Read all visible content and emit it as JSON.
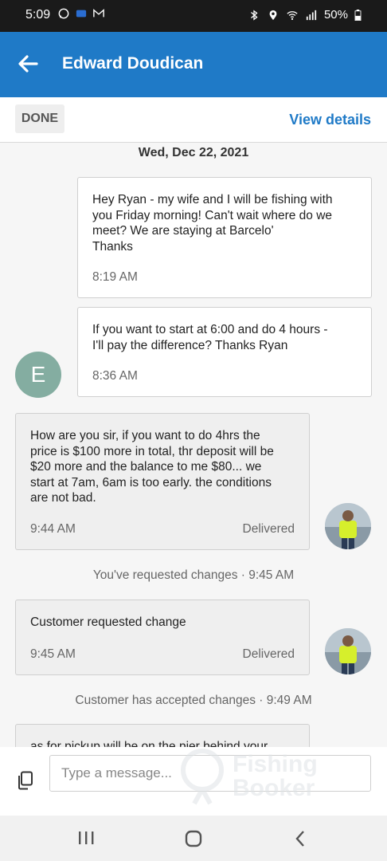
{
  "status_bar": {
    "time": "5:09",
    "battery": "50%",
    "icons": [
      "whatsapp-icon",
      "app-icon",
      "gmail-icon",
      "bluetooth-icon",
      "location-icon",
      "wifi-icon",
      "signal-icon",
      "battery-icon"
    ]
  },
  "header": {
    "title": "Edward Doudican",
    "back_icon": "arrow-left-icon",
    "color": "#1f7ac7"
  },
  "toolbar": {
    "done_label": "DONE",
    "view_details_label": "View details"
  },
  "chat": {
    "date": "Wed, Dec 22, 2021",
    "messages": [
      {
        "direction": "incoming",
        "text": "Hey Ryan - my wife and I will be fishing with\nyou Friday morning! Can't wait where do we\nmeet? We are staying at Barcelo'\nThanks",
        "time": "8:19 AM"
      },
      {
        "direction": "incoming",
        "text": "If you want to start at 6:00 and do 4 hours -\nI'll pay the difference? Thanks Ryan",
        "time": "8:36 AM",
        "avatar_letter": "E"
      },
      {
        "direction": "outgoing",
        "text": "How are you sir, if you want to do 4hrs the\nprice is $100 more in total, thr deposit will be\n$20 more and the balance to me $80... we\nstart at 7am, 6am is too early. the conditions\nare not bad.",
        "time": "9:44 AM",
        "status": "Delivered"
      },
      {
        "direction": "outgoing",
        "text": "Customer requested change",
        "time": "9:45 AM",
        "status": "Delivered"
      },
      {
        "direction": "outgoing",
        "text": "as for pickup will be on the pier behind your",
        "time": "",
        "status": ""
      }
    ],
    "system_notes": [
      "You've requested changes · 9:45 AM",
      "Customer has accepted changes · 9:49 AM"
    ]
  },
  "composer": {
    "placeholder": "Type a message...",
    "watermark_line1": "Fishing",
    "watermark_line2": "Booker"
  },
  "nav_bar": {
    "icons": [
      "recent-apps-icon",
      "home-icon",
      "back-icon"
    ]
  }
}
